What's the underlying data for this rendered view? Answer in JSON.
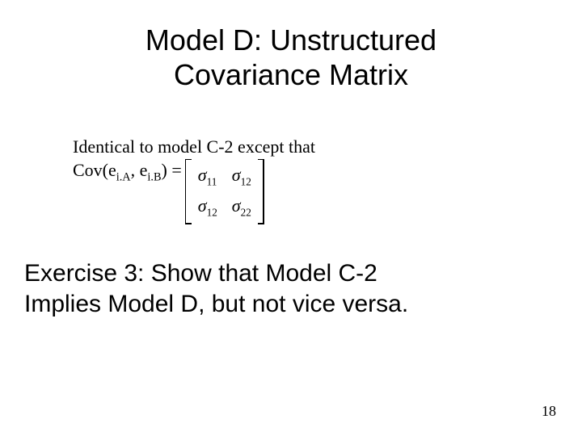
{
  "title": {
    "line1": "Model D:  Unstructured",
    "line2": "Covariance Matrix"
  },
  "body": {
    "intro": "Identical to model C-2 except that",
    "cov_prefix": "Cov(e",
    "cov_sub1": "i.A",
    "cov_mid": ", e",
    "cov_sub2": "i.B",
    "cov_suffix": ") ="
  },
  "matrix": {
    "sigma": "σ",
    "s11": "11",
    "s12a": "12",
    "s12b": "12",
    "s22": "22"
  },
  "exercise": {
    "line1": "Exercise 3: Show that Model C-2",
    "line2": "Implies Model D, but not vice versa."
  },
  "page_number": "18"
}
